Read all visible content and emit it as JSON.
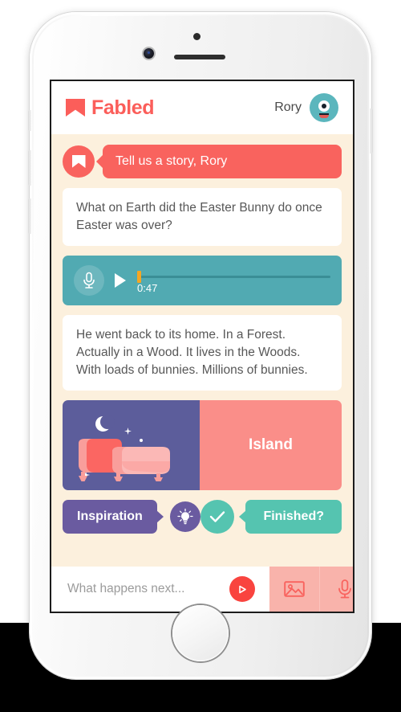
{
  "header": {
    "brand_name": "Fabled",
    "brand_icon": "bookmark-icon",
    "user_name": "Rory",
    "avatar_icon": "robot-avatar-icon"
  },
  "conversation": {
    "prompt": {
      "avatar_icon": "bookmark-icon",
      "text": "Tell us a story, Rory"
    },
    "question_card": {
      "text": "What on Earth did the Easter Bunny do once Easter was over?"
    },
    "audio": {
      "mic_icon": "microphone-icon",
      "play_icon": "play-icon",
      "time": "0:47",
      "progress_percent": 0
    },
    "story_card": {
      "text": "He went back to its home. In a Forest. Actually in a Wood. It lives in the Woods. With loads of bunnies. Millions of bunnies."
    },
    "media": {
      "illustration_name": "magic-carpet-night-illustration",
      "tag_label": "Island"
    },
    "actions": {
      "inspiration_label": "Inspiration",
      "bulb_icon": "lightbulb-icon",
      "check_icon": "check-icon",
      "finished_label": "Finished?"
    }
  },
  "composer": {
    "placeholder": "What happens next...",
    "value": "",
    "send_icon": "send-play-icon",
    "image_icon": "image-icon",
    "mic_icon": "microphone-icon"
  },
  "colors": {
    "brand_red": "#fb5e5a",
    "bubble_red": "#f9635e",
    "send_red": "#f9443f",
    "composer_icon_bg": "#f9b3ab",
    "cream_bg": "#fcf0dd",
    "teal_audio": "#51aab2",
    "teal_avatar": "#5bb6bd",
    "teal_finished": "#55c4b0",
    "purple_illustration": "#5c5d9b",
    "purple_button": "#6a5ba0",
    "salmon_tag": "#fa8e89",
    "text_gray": "#575757"
  }
}
